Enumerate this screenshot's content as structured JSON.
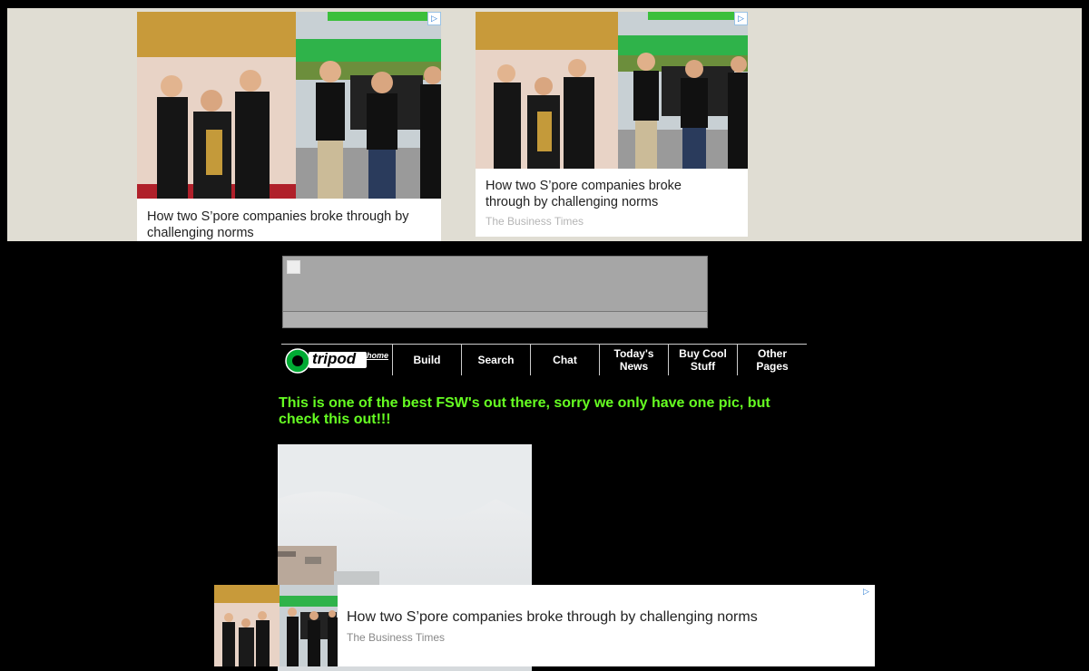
{
  "ads": {
    "card1": {
      "title": "How two S’pore companies broke through by challenging norms"
    },
    "card2": {
      "title": "How two S’pore companies broke through by challenging norms",
      "source": "The Business Times"
    },
    "bottom": {
      "title": "How two S’pore companies broke through by challenging norms",
      "source": "The Business Times"
    },
    "adchoices_icon": "ad-choices-icon"
  },
  "nav": {
    "logo_text": "tripod",
    "logo_sub": "home",
    "items": [
      {
        "label": "Build"
      },
      {
        "label": "Search"
      },
      {
        "label": "Chat"
      },
      {
        "label": "Today's News"
      },
      {
        "label": "Buy Cool Stuff"
      },
      {
        "label": "Other Pages"
      }
    ]
  },
  "content": {
    "headline": "This is one of the best FSW's out there, sorry we only have one pic, but check this out!!!"
  },
  "colors": {
    "background": "#000000",
    "headline": "#66ff22",
    "ad_band": "#e0ddd3",
    "banner": "#a6a6a6"
  }
}
